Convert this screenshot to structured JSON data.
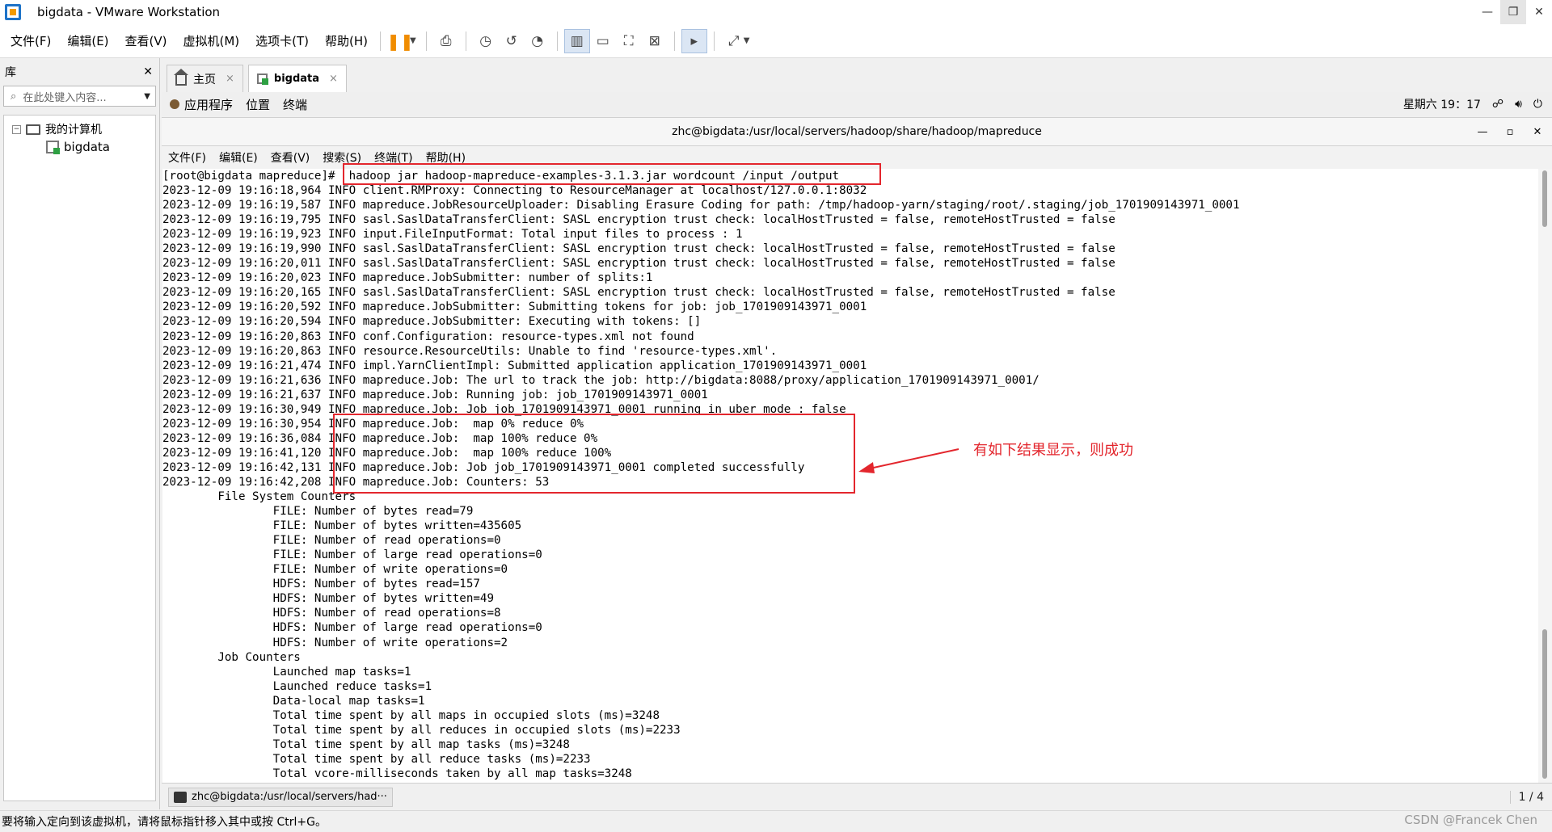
{
  "window": {
    "title": "bigdata - VMware Workstation",
    "minimize_glyph": "—",
    "restore_glyph": "❐",
    "close_glyph": "✕"
  },
  "menu": [
    "文件(F)",
    "编辑(E)",
    "查看(V)",
    "虚拟机(M)",
    "选项卡(T)",
    "帮助(H)"
  ],
  "library": {
    "title": "库",
    "close_glyph": "✕",
    "search_placeholder": "在此处键入内容...",
    "tree": {
      "root": "我的计算机",
      "child": "bigdata",
      "toggle_glyph": "−"
    }
  },
  "tabs": [
    {
      "label": "主页"
    },
    {
      "label": "bigdata"
    }
  ],
  "tab_close_glyph": "×",
  "gnome": {
    "apps": "应用程序",
    "places": "位置",
    "terminal": "终端",
    "clock": "星期六 19：17"
  },
  "terminal_window": {
    "title": "zhc@bigdata:/usr/local/servers/hadoop/share/hadoop/mapreduce",
    "menu": [
      "文件(F)",
      "编辑(E)",
      "查看(V)",
      "搜索(S)",
      "终端(T)",
      "帮助(H)"
    ],
    "lines": [
      "[root@bigdata mapreduce]#  hadoop jar hadoop-mapreduce-examples-3.1.3.jar wordcount /input /output",
      "2023-12-09 19:16:18,964 INFO client.RMProxy: Connecting to ResourceManager at localhost/127.0.0.1:8032",
      "2023-12-09 19:16:19,587 INFO mapreduce.JobResourceUploader: Disabling Erasure Coding for path: /tmp/hadoop-yarn/staging/root/.staging/job_1701909143971_0001",
      "2023-12-09 19:16:19,795 INFO sasl.SaslDataTransferClient: SASL encryption trust check: localHostTrusted = false, remoteHostTrusted = false",
      "2023-12-09 19:16:19,923 INFO input.FileInputFormat: Total input files to process : 1",
      "2023-12-09 19:16:19,990 INFO sasl.SaslDataTransferClient: SASL encryption trust check: localHostTrusted = false, remoteHostTrusted = false",
      "2023-12-09 19:16:20,011 INFO sasl.SaslDataTransferClient: SASL encryption trust check: localHostTrusted = false, remoteHostTrusted = false",
      "2023-12-09 19:16:20,023 INFO mapreduce.JobSubmitter: number of splits:1",
      "2023-12-09 19:16:20,165 INFO sasl.SaslDataTransferClient: SASL encryption trust check: localHostTrusted = false, remoteHostTrusted = false",
      "2023-12-09 19:16:20,592 INFO mapreduce.JobSubmitter: Submitting tokens for job: job_1701909143971_0001",
      "2023-12-09 19:16:20,594 INFO mapreduce.JobSubmitter: Executing with tokens: []",
      "2023-12-09 19:16:20,863 INFO conf.Configuration: resource-types.xml not found",
      "2023-12-09 19:16:20,863 INFO resource.ResourceUtils: Unable to find 'resource-types.xml'.",
      "2023-12-09 19:16:21,474 INFO impl.YarnClientImpl: Submitted application application_1701909143971_0001",
      "2023-12-09 19:16:21,636 INFO mapreduce.Job: The url to track the job: http://bigdata:8088/proxy/application_1701909143971_0001/",
      "2023-12-09 19:16:21,637 INFO mapreduce.Job: Running job: job_1701909143971_0001",
      "2023-12-09 19:16:30,949 INFO mapreduce.Job: Job job_1701909143971_0001 running in uber mode : false",
      "2023-12-09 19:16:30,954 INFO mapreduce.Job:  map 0% reduce 0%",
      "2023-12-09 19:16:36,084 INFO mapreduce.Job:  map 100% reduce 0%",
      "2023-12-09 19:16:41,120 INFO mapreduce.Job:  map 100% reduce 100%",
      "2023-12-09 19:16:42,131 INFO mapreduce.Job: Job job_1701909143971_0001 completed successfully",
      "2023-12-09 19:16:42,208 INFO mapreduce.Job: Counters: 53",
      "        File System Counters",
      "                FILE: Number of bytes read=79",
      "                FILE: Number of bytes written=435605",
      "                FILE: Number of read operations=0",
      "                FILE: Number of large read operations=0",
      "                FILE: Number of write operations=0",
      "                HDFS: Number of bytes read=157",
      "                HDFS: Number of bytes written=49",
      "                HDFS: Number of read operations=8",
      "                HDFS: Number of large read operations=0",
      "                HDFS: Number of write operations=2",
      "        Job Counters",
      "                Launched map tasks=1",
      "                Launched reduce tasks=1",
      "                Data-local map tasks=1",
      "                Total time spent by all maps in occupied slots (ms)=3248",
      "                Total time spent by all reduces in occupied slots (ms)=2233",
      "                Total time spent by all map tasks (ms)=3248",
      "                Total time spent by all reduce tasks (ms)=2233",
      "                Total vcore-milliseconds taken by all map tasks=3248"
    ]
  },
  "annotation": {
    "text": "有如下结果显示，则成功",
    "color": "#e3262d"
  },
  "taskbar": {
    "item": "zhc@bigdata:/usr/local/servers/had···",
    "workspace": "1 / 4"
  },
  "status": {
    "text": "要将输入定向到该虚拟机，请将鼠标指针移入其中或按 Ctrl+G。"
  },
  "watermark": "CSDN @Francek Chen"
}
